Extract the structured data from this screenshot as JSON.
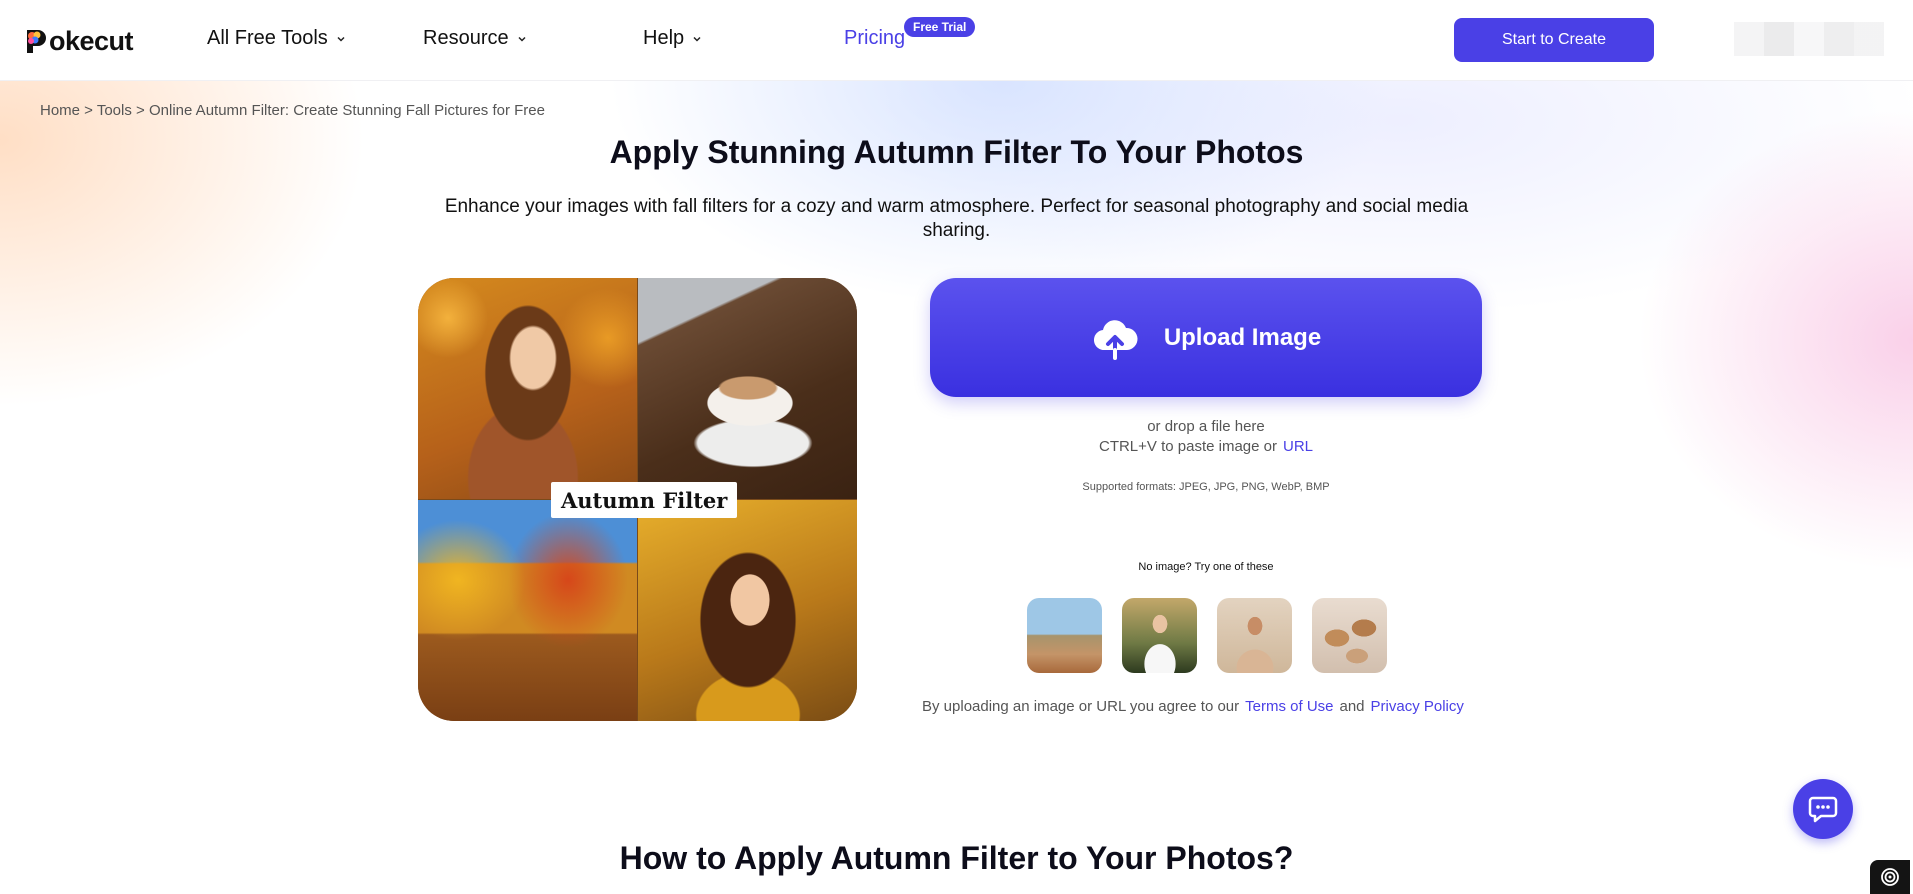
{
  "header": {
    "logo_text": "okecut",
    "nav": [
      {
        "label": "All Free Tools",
        "icon": "chevron-down-icon"
      },
      {
        "label": "Resource",
        "icon": "chevron-down-icon"
      },
      {
        "label": "Help",
        "icon": "chevron-down-icon"
      },
      {
        "label": "Pricing"
      }
    ],
    "badge": "Free Trial",
    "cta": "Start to Create",
    "accent_color": "#4a40e6"
  },
  "breadcrumb": {
    "home": "Home",
    "sep1": " > ",
    "tools": "Tools",
    "sep2": " > ",
    "current": "Online Autumn Filter: Create Stunning Fall Pictures for Free"
  },
  "hero": {
    "title": "Apply Stunning Autumn Filter To Your Photos",
    "subtitle": "Enhance your images with fall filters for a cozy and warm atmosphere. Perfect for seasonal photography and social media sharing."
  },
  "collage": {
    "label": "Autumn Filter"
  },
  "upload": {
    "button_label": "Upload Image",
    "icon": "cloud-upload-icon",
    "drop_text": "or drop a file here",
    "paste_text": "CTRL+V to paste image or",
    "url_label": "URL",
    "formats": "Supported formats: JPEG, JPG, PNG, WebP, BMP",
    "no_image": "No image? Try one of these",
    "terms_prefix": "By uploading an image or URL you agree to our",
    "terms_link": "Terms of Use",
    "terms_and": "and",
    "privacy_link": "Privacy Policy"
  },
  "section": {
    "title": "How to Apply Autumn Filter to Your Photos?"
  }
}
